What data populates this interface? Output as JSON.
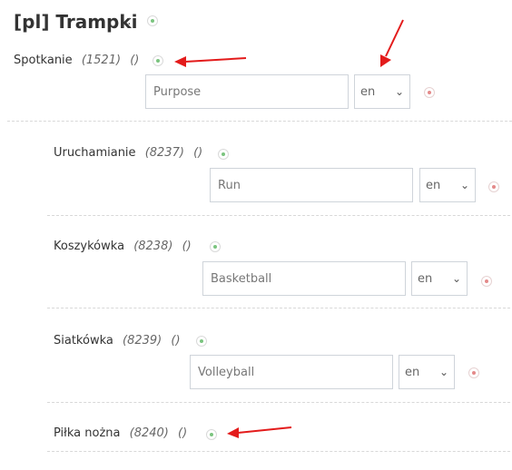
{
  "header": {
    "title": "[pl] Trampki",
    "colon": ":"
  },
  "items": [
    {
      "name": "Spotkanie",
      "id": "(1521)",
      "extra": "()",
      "placeholder": "Purpose",
      "lang": "en"
    },
    {
      "name": "Uruchamianie",
      "id": "(8237)",
      "extra": "()",
      "placeholder": "Run",
      "lang": "en"
    },
    {
      "name": "Koszykówka",
      "id": "(8238)",
      "extra": "()",
      "placeholder": "Basketball",
      "lang": "en"
    },
    {
      "name": "Siatkówka",
      "id": "(8239)",
      "extra": "()",
      "placeholder": "Volleyball",
      "lang": "en"
    },
    {
      "name": "Piłka nożna",
      "id": "(8240)",
      "extra": "()"
    }
  ],
  "annotations": {
    "arrow_color": "#e31b1b",
    "add_color": "#7bc47f",
    "remove_color": "#e48a8a"
  }
}
